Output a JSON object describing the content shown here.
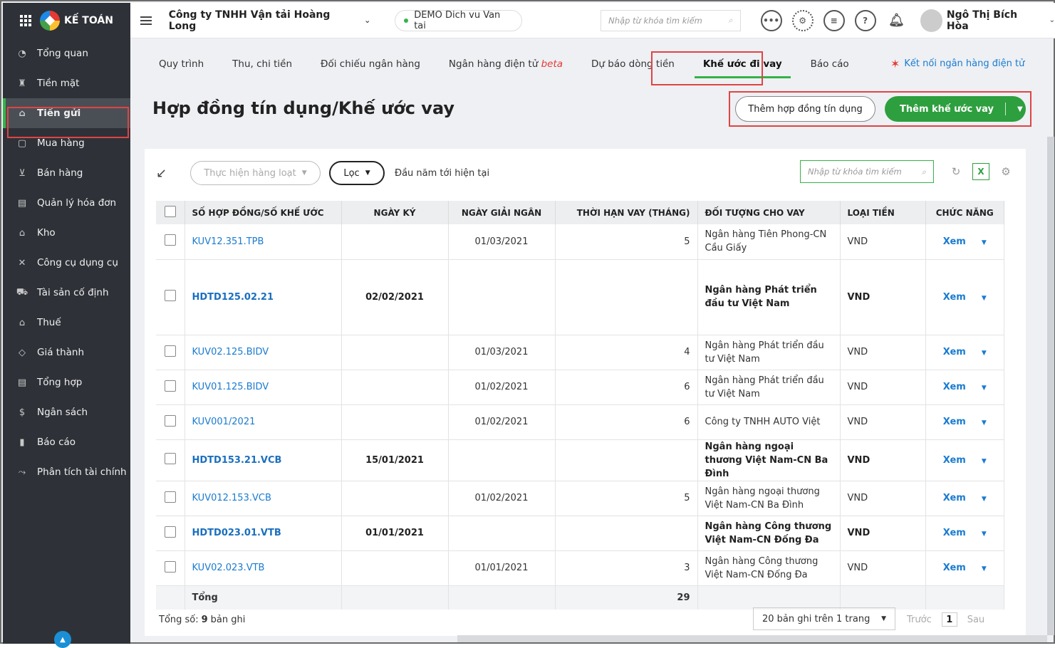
{
  "app": {
    "brand": "KẾ TOÁN"
  },
  "sidebar": {
    "items": [
      {
        "label": "Tổng quan",
        "icon": "dashboard-icon",
        "glyph": "◔"
      },
      {
        "label": "Tiền mặt",
        "icon": "cash-icon",
        "glyph": "♜"
      },
      {
        "label": "Tiền gửi",
        "icon": "bank-icon",
        "glyph": "⌂",
        "active": true
      },
      {
        "label": "Mua hàng",
        "icon": "bag-icon",
        "glyph": "▢"
      },
      {
        "label": "Bán hàng",
        "icon": "cart-icon",
        "glyph": "⊻"
      },
      {
        "label": "Quản lý hóa đơn",
        "icon": "invoice-icon",
        "glyph": "▤"
      },
      {
        "label": "Kho",
        "icon": "warehouse-icon",
        "glyph": "⌂"
      },
      {
        "label": "Công cụ dụng cụ",
        "icon": "tools-icon",
        "glyph": "✕"
      },
      {
        "label": "Tài sản cố định",
        "icon": "asset-icon",
        "glyph": "⛟"
      },
      {
        "label": "Thuế",
        "icon": "tax-icon",
        "glyph": "⌂"
      },
      {
        "label": "Giá thành",
        "icon": "price-tag-icon",
        "glyph": "◇"
      },
      {
        "label": "Tổng hợp",
        "icon": "summary-icon",
        "glyph": "▤"
      },
      {
        "label": "Ngân sách",
        "icon": "budget-icon",
        "glyph": "$"
      },
      {
        "label": "Báo cáo",
        "icon": "report-icon",
        "glyph": "▮"
      },
      {
        "label": "Phân tích tài chính",
        "icon": "analysis-icon",
        "glyph": "⤳"
      }
    ]
  },
  "topbar": {
    "company": "Công ty TNHH Vận tải Hoàng Long",
    "demo": "DEMO Dich vu Van tai",
    "search_placeholder": "Nhập từ khóa tìm kiếm",
    "user": "Ngô Thị Bích Hòa"
  },
  "tabs": [
    {
      "label": "Quy trình"
    },
    {
      "label": "Thu, chi tiền"
    },
    {
      "label": "Đối chiếu ngân hàng"
    },
    {
      "label": "Ngân hàng điện tử",
      "badge": "beta"
    },
    {
      "label": "Dự báo dòng tiền"
    },
    {
      "label": "Khế ước đi vay",
      "active": true
    },
    {
      "label": "Báo cáo"
    }
  ],
  "connect_label": "Kết nối ngân hàng điện tử",
  "page": {
    "title": "Hợp đồng tín dụng/Khế ước vay",
    "add_contract": "Thêm hợp đồng tín dụng",
    "add_loan": "Thêm khế ước vay"
  },
  "toolbar": {
    "bulk": "Thực hiện hàng loạt",
    "filter": "Lọc",
    "period": "Đầu năm tới hiện tại",
    "search_placeholder": "Nhập từ khóa tìm kiếm"
  },
  "table": {
    "headers": [
      "SỐ HỢP ĐỒNG/SỐ KHẾ ƯỚC",
      "NGÀY KÝ",
      "NGÀY GIẢI NGÂN",
      "THỜI HẠN VAY (THÁNG)",
      "ĐỐI TƯỢNG CHO VAY",
      "LOẠI TIỀN",
      "CHỨC NĂNG"
    ],
    "rows": [
      {
        "no": "KUV12.351.TPB",
        "sign": "",
        "disb": "01/03/2021",
        "term": "5",
        "lender": "Ngân hàng Tiên Phong-CN Cầu Giấy",
        "cur": "VND",
        "fn": "Xem",
        "bold": false
      },
      {
        "no": "HDTD125.02.21",
        "sign": "02/02/2021",
        "disb": "",
        "term": "",
        "lender": "Ngân hàng Phát triển đầu tư Việt Nam",
        "cur": "VND",
        "fn": "Xem",
        "bold": true
      },
      {
        "no": "KUV02.125.BIDV",
        "sign": "",
        "disb": "01/03/2021",
        "term": "4",
        "lender": "Ngân hàng Phát triển đầu tư Việt Nam",
        "cur": "VND",
        "fn": "Xem",
        "bold": false
      },
      {
        "no": "KUV01.125.BIDV",
        "sign": "",
        "disb": "01/02/2021",
        "term": "6",
        "lender": "Ngân hàng Phát triển đầu tư Việt Nam",
        "cur": "VND",
        "fn": "Xem",
        "bold": false
      },
      {
        "no": "KUV001/2021",
        "sign": "",
        "disb": "01/02/2021",
        "term": "6",
        "lender": "Công ty TNHH AUTO Việt",
        "cur": "VND",
        "fn": "Xem",
        "bold": false
      },
      {
        "no": "HDTD153.21.VCB",
        "sign": "15/01/2021",
        "disb": "",
        "term": "",
        "lender": "Ngân hàng ngoại thương Việt Nam-CN Ba Đình",
        "cur": "VND",
        "fn": "Xem",
        "bold": true
      },
      {
        "no": "KUV012.153.VCB",
        "sign": "",
        "disb": "01/02/2021",
        "term": "5",
        "lender": "Ngân hàng ngoại thương Việt Nam-CN Ba Đình",
        "cur": "VND",
        "fn": "Xem",
        "bold": false
      },
      {
        "no": "HDTD023.01.VTB",
        "sign": "01/01/2021",
        "disb": "",
        "term": "",
        "lender": "Ngân hàng Công thương Việt Nam-CN Đống Đa",
        "cur": "VND",
        "fn": "Xem",
        "bold": true
      },
      {
        "no": "KUV02.023.VTB",
        "sign": "",
        "disb": "01/01/2021",
        "term": "3",
        "lender": "Ngân hàng Công thương Việt Nam-CN Đống Đa",
        "cur": "VND",
        "fn": "Xem",
        "bold": false
      }
    ],
    "total_label": "Tổng",
    "total_term": "29"
  },
  "footer": {
    "count_prefix": "Tổng số:",
    "count": "9",
    "count_suffix": "bản ghi",
    "page_size": "20 bản ghi trên 1 trang",
    "prev": "Trước",
    "page": "1",
    "next": "Sau"
  }
}
